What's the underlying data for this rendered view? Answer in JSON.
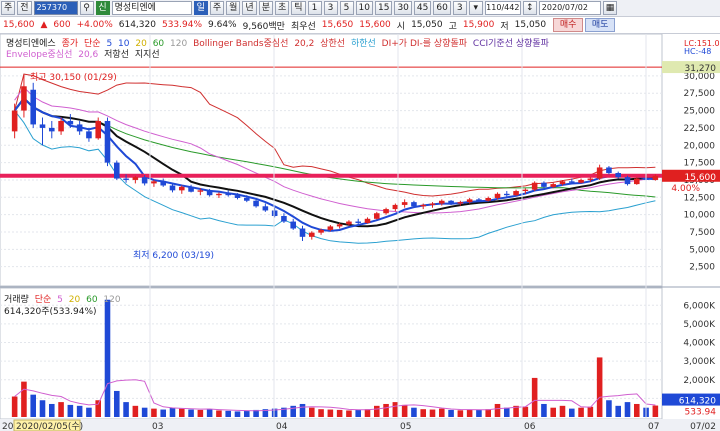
{
  "toolbar": {
    "menu_label": "주",
    "prev_label": "전",
    "stock_code": "257370",
    "search_icon": "search-icon",
    "badge": "신",
    "stock_name": "명성티엔에",
    "periods": [
      "일",
      "주",
      "월",
      "년",
      "분",
      "초",
      "틱"
    ],
    "selected_period": "일",
    "intervals": [
      "1",
      "3",
      "5",
      "10",
      "15",
      "30",
      "45",
      "60",
      "3"
    ],
    "count": "110/442",
    "date": "2020/07/02"
  },
  "quote": {
    "price": "15,600",
    "change": "600",
    "change_pct": "+4.00%",
    "volume": "614,320",
    "volume_ratio": "533.94%",
    "turnover": "9.64%",
    "amount": "9,560백만",
    "best_ask_label": "최우선",
    "best_ask": "15,650",
    "best_bid": "15,600",
    "open_label": "시",
    "open": "15,050",
    "high_label": "고",
    "high": "15,900",
    "low_label": "저",
    "low": "15,050",
    "buy_label": "매수",
    "sell_label": "매도"
  },
  "price_pane": {
    "legend1": [
      "명성티엔에스",
      "종가",
      "단순",
      "5",
      "10",
      "20",
      "60",
      "120",
      "Bollinger Bands중심선",
      "20,2",
      "상한선",
      "하한선",
      "DI+가 DI-를 상향돌파",
      "CCI기준선 상향돌파"
    ],
    "legend2": [
      "Envelope중심선",
      "20,6",
      "저항선",
      "지지선"
    ],
    "high_annotation": "최고 30,150 (01/29)",
    "low_annotation": "최저 6,200 (03/19)",
    "hc_label": "LC:151.0",
    "hc_label2": "HC:-48",
    "top_price_box": "31,270",
    "current_price_box": "15,600",
    "current_pct_box": "4.00%",
    "y_ticks": [
      "30,000",
      "27,500",
      "25,000",
      "22,500",
      "20,000",
      "17,500",
      "15,000",
      "12,500",
      "10,000",
      "7,500",
      "5,000",
      "2,500"
    ]
  },
  "volume_pane": {
    "legend": [
      "거래량",
      "단순",
      "5",
      "20",
      "60",
      "120"
    ],
    "info": "614,320주(533.94%)",
    "y_ticks": [
      "6,000K",
      "5,000K",
      "4,000K",
      "3,000K",
      "2,000K",
      "1,000K"
    ],
    "current_box": "614,320",
    "current_pct_box": "533.94"
  },
  "x_axis": {
    "date_box": "2020/02/05(수)",
    "left_label": "20",
    "months": [
      "03",
      "04",
      "05",
      "06",
      "07"
    ],
    "right_label": "07/02"
  },
  "colors": {
    "up": "#e02020",
    "down": "#1f49d6",
    "current_line": "#e8205a",
    "ma5": "#1f49d6",
    "ma10": "#111111",
    "ma20": "#e0d000",
    "ma60": "#2a9a2a",
    "ma120": "#999999",
    "bb": "#d03030",
    "env": "#d060d0"
  },
  "chart_data": {
    "type": "candlestick",
    "price_ylim": [
      0,
      32000
    ],
    "volume_ylim": [
      0,
      6500000
    ],
    "candles": [
      [
        22000,
        26000,
        21000,
        25000
      ],
      [
        25000,
        30150,
        24000,
        28500
      ],
      [
        28000,
        29000,
        22500,
        23000
      ],
      [
        23000,
        24000,
        20000,
        22500
      ],
      [
        22500,
        23500,
        21000,
        22000
      ],
      [
        22000,
        24000,
        21500,
        23500
      ],
      [
        23500,
        24500,
        22500,
        23000
      ],
      [
        23000,
        23500,
        21500,
        22000
      ],
      [
        22000,
        22500,
        20500,
        21000
      ],
      [
        21000,
        24000,
        20800,
        23500
      ],
      [
        23500,
        24000,
        17000,
        17500
      ],
      [
        17500,
        17800,
        15000,
        15200
      ],
      [
        15200,
        15800,
        14600,
        15000
      ],
      [
        15000,
        15600,
        14500,
        15400
      ],
      [
        15400,
        15700,
        14200,
        14500
      ],
      [
        14500,
        15000,
        14000,
        14800
      ],
      [
        14800,
        15200,
        14000,
        14200
      ],
      [
        14200,
        14500,
        13200,
        13500
      ],
      [
        13500,
        14200,
        13000,
        14000
      ],
      [
        14000,
        14300,
        13200,
        13300
      ],
      [
        13300,
        13800,
        12800,
        13500
      ],
      [
        13500,
        13700,
        12600,
        12800
      ],
      [
        12800,
        13200,
        12400,
        13000
      ],
      [
        13000,
        13500,
        12600,
        12800
      ],
      [
        12800,
        13100,
        12200,
        12400
      ],
      [
        12400,
        12800,
        11800,
        12000
      ],
      [
        12000,
        12300,
        11000,
        11200
      ],
      [
        11200,
        11600,
        10400,
        10600
      ],
      [
        10600,
        11000,
        9600,
        9800
      ],
      [
        9800,
        10200,
        8800,
        9000
      ],
      [
        9000,
        9400,
        7800,
        8000
      ],
      [
        8000,
        8400,
        6200,
        6800
      ],
      [
        6800,
        7600,
        6400,
        7400
      ],
      [
        7400,
        8000,
        7100,
        7800
      ],
      [
        7800,
        8500,
        7600,
        8300
      ],
      [
        8300,
        8800,
        8000,
        8600
      ],
      [
        8600,
        9200,
        8400,
        9000
      ],
      [
        9000,
        9400,
        8600,
        8800
      ],
      [
        8800,
        9600,
        8700,
        9400
      ],
      [
        9400,
        10400,
        9300,
        10200
      ],
      [
        10200,
        11000,
        10000,
        10800
      ],
      [
        10800,
        11600,
        10500,
        11400
      ],
      [
        11400,
        12200,
        11000,
        11800
      ],
      [
        11800,
        12000,
        11000,
        11200
      ],
      [
        11200,
        11600,
        10800,
        11400
      ],
      [
        11400,
        11800,
        11000,
        11600
      ],
      [
        11600,
        12200,
        11300,
        12000
      ],
      [
        12000,
        12100,
        11400,
        11600
      ],
      [
        11600,
        12000,
        11300,
        11800
      ],
      [
        11800,
        12400,
        11600,
        12200
      ],
      [
        12200,
        12400,
        11800,
        12000
      ],
      [
        12000,
        12600,
        11900,
        12400
      ],
      [
        12400,
        13200,
        12200,
        13000
      ],
      [
        13000,
        13400,
        12600,
        12800
      ],
      [
        12800,
        13600,
        12700,
        13400
      ],
      [
        13400,
        13800,
        13000,
        13600
      ],
      [
        13600,
        14800,
        13400,
        14600
      ],
      [
        14600,
        14800,
        13800,
        14000
      ],
      [
        14000,
        14600,
        13800,
        14400
      ],
      [
        14400,
        15000,
        14200,
        14800
      ],
      [
        14800,
        15200,
        14400,
        14600
      ],
      [
        14600,
        15200,
        14500,
        15000
      ],
      [
        15000,
        15400,
        14700,
        15200
      ],
      [
        15200,
        17200,
        15000,
        16800
      ],
      [
        16800,
        17000,
        15800,
        16000
      ],
      [
        16000,
        16200,
        15200,
        15400
      ],
      [
        15400,
        15600,
        14200,
        14400
      ],
      [
        14400,
        15400,
        14300,
        15200
      ],
      [
        15200,
        15600,
        14800,
        15000
      ],
      [
        15000,
        15800,
        14900,
        15600
      ]
    ],
    "volumes": [
      1100000,
      1900000,
      1200000,
      900000,
      700000,
      800000,
      650000,
      600000,
      500000,
      900000,
      6300000,
      1400000,
      800000,
      600000,
      500000,
      450000,
      400000,
      500000,
      450000,
      400000,
      380000,
      420000,
      350000,
      330000,
      300000,
      320000,
      380000,
      420000,
      450000,
      500000,
      600000,
      700000,
      500000,
      420000,
      400000,
      380000,
      350000,
      400000,
      420000,
      600000,
      700000,
      800000,
      650000,
      500000,
      420000,
      400000,
      450000,
      380000,
      360000,
      400000,
      380000,
      420000,
      700000,
      500000,
      600000,
      550000,
      2100000,
      700000,
      500000,
      600000,
      450000,
      500000,
      550000,
      3200000,
      900000,
      600000,
      800000,
      700000,
      500000,
      614320
    ]
  }
}
